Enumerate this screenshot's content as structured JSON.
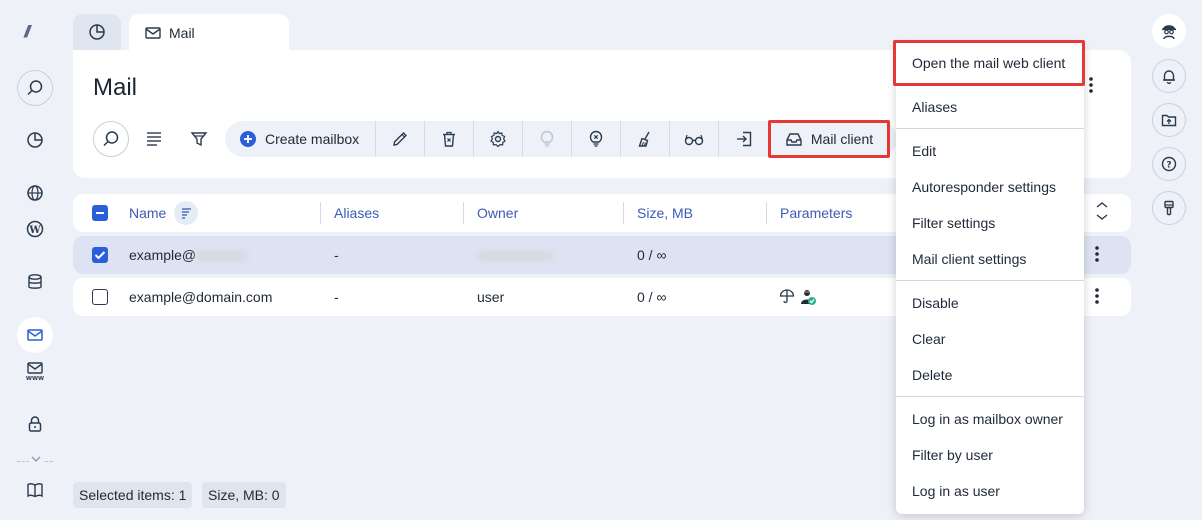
{
  "tabs": {
    "mail_label": "Mail"
  },
  "page": {
    "title": "Mail"
  },
  "toolbar": {
    "create_label": "Create mailbox",
    "mail_client_label": "Mail client"
  },
  "table": {
    "columns": [
      "Name",
      "Aliases",
      "Owner",
      "Size, MB",
      "Parameters"
    ],
    "rows": [
      {
        "name": "example@",
        "aliases": "-",
        "owner": "",
        "size": "0 / ∞",
        "selected": true
      },
      {
        "name": "example@domain.com",
        "aliases": "-",
        "owner": "user",
        "size": "0 / ∞",
        "selected": false
      }
    ]
  },
  "footer": {
    "selected_items": "Selected items: 1",
    "size": "Size, MB: 0"
  },
  "menu": {
    "items": [
      "Open the mail web client",
      "Aliases",
      "Edit",
      "Autoresponder settings",
      "Filter settings",
      "Mail client settings",
      "Disable",
      "Clear",
      "Delete",
      "Log in as mailbox owner",
      "Filter by user",
      "Log in as user"
    ]
  },
  "colors": {
    "accent": "#2b5fd9",
    "highlight_border": "#e53935",
    "background": "#eef2f8"
  }
}
